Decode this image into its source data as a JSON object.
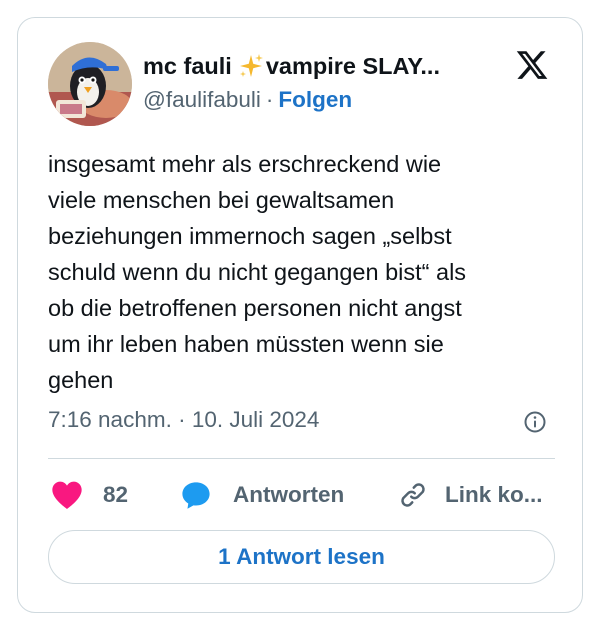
{
  "author": {
    "display_name_part1": "mc fauli",
    "display_name_part2": "vampire SLAY...",
    "handle": "@faulifabuli",
    "separator": "·",
    "follow_label": "Folgen",
    "avatar_icon": "profile-avatar",
    "badge_icon": "sparkles-emoji"
  },
  "platform_logo": "x-logo",
  "tweet": {
    "text": "insgesamt mehr als erschreckend wie\nviele menschen bei gewaltsamen\nbeziehungen immernoch sagen „selbst\nschuld wenn du nicht gegangen bist“ als\nob die betroffenen personen nicht angst\num ihr leben haben müssten wenn sie\ngehen",
    "timestamp": "7:16 nachm. · 10. Juli 2024"
  },
  "actions": {
    "like_count": "82",
    "reply_label": "Antworten",
    "copy_link_label": "Link ko..."
  },
  "read_replies_label": "1 Antwort lesen",
  "colors": {
    "like": "#f91880",
    "reply": "#1d9bf0",
    "link": "#1d73c7",
    "secondary_text": "#536471",
    "border": "#cfd9de",
    "sparkle": "#f5b82e"
  }
}
